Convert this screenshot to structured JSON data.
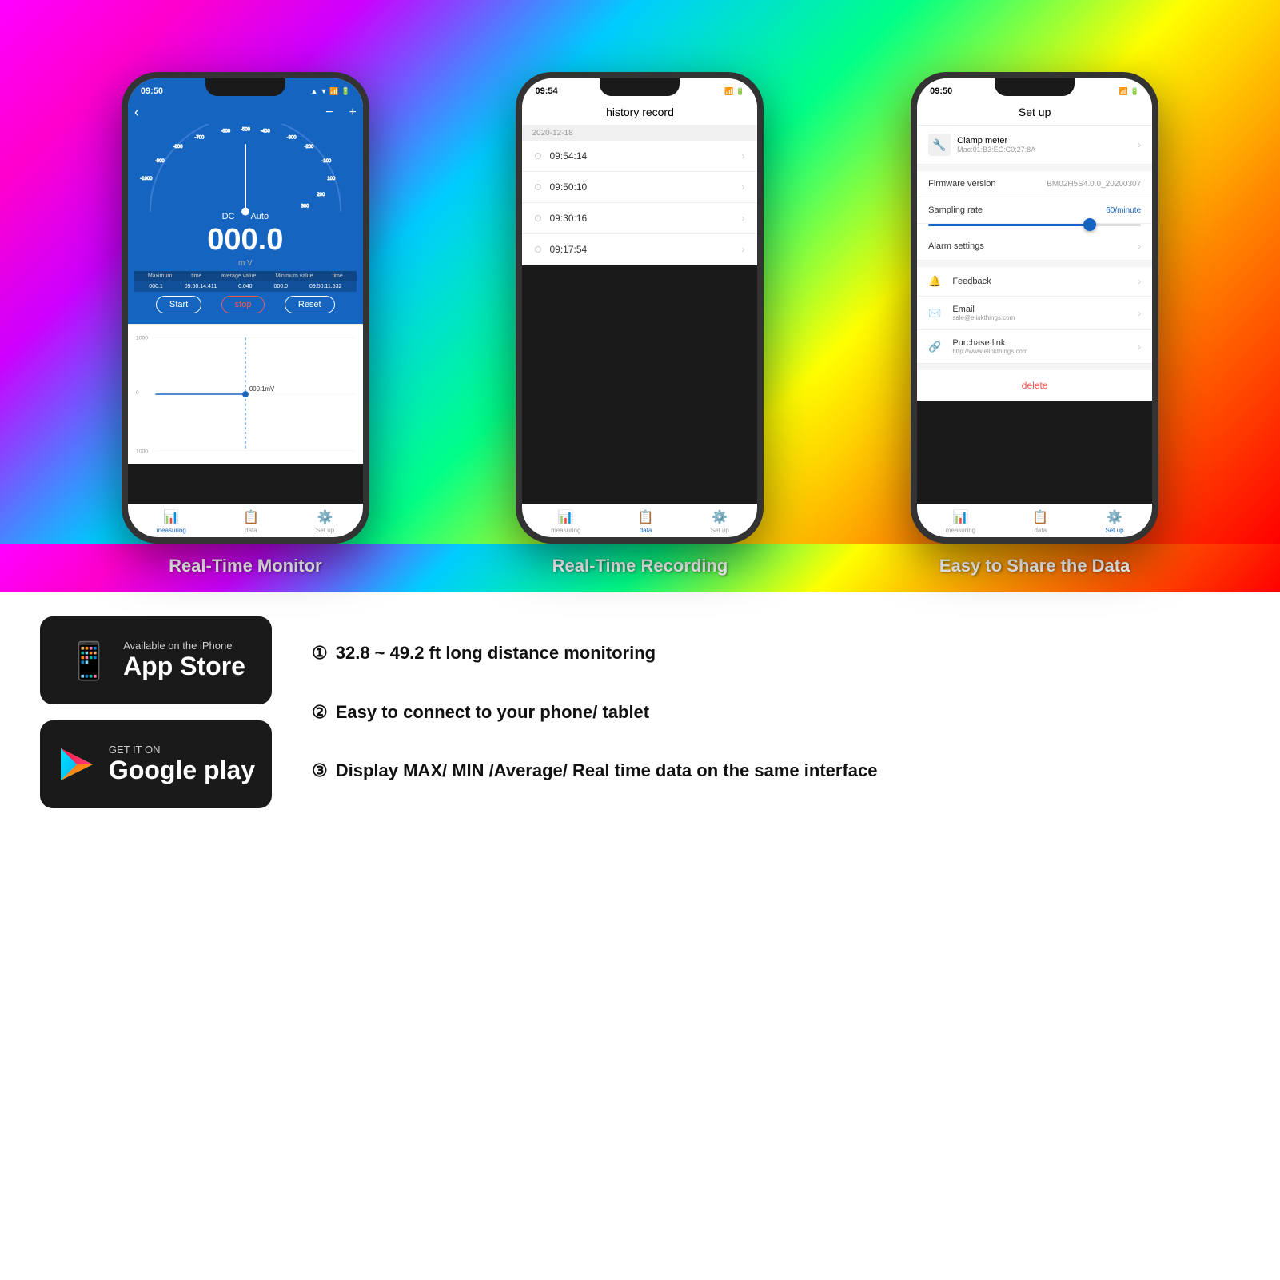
{
  "phones": [
    {
      "name": "measuring",
      "time": "09:50",
      "title": "Real-Time Monitor",
      "dc": "DC",
      "auto": "Auto",
      "value": "000.0",
      "unit": "m V",
      "stats": {
        "max_label": "Maximum",
        "max_val": "000.1",
        "time1_label": "time",
        "time1_val": "09:50:14.411",
        "avg_label": "average value",
        "avg_val": "0.040",
        "min_label": "Minimum value",
        "min_val": "000.0",
        "time2_label": "time",
        "time2_val": "09:50:11.532"
      },
      "buttons": {
        "start": "Start",
        "stop": "stop",
        "reset": "Reset"
      },
      "chart_value": "000.1mV",
      "footer": {
        "measuring": "measuring",
        "data": "data",
        "setup": "Set up"
      }
    },
    {
      "name": "history",
      "time": "09:54",
      "title": "Real-Time Recording",
      "screen_title": "history record",
      "date": "2020-12-18",
      "records": [
        "09:54:14",
        "09:50:10",
        "09:30:16",
        "09:17:54"
      ],
      "footer": {
        "measuring": "measuring",
        "data": "data",
        "setup": "Set up"
      }
    },
    {
      "name": "setup",
      "time": "09:50",
      "title": "Easy to Share the Data",
      "screen_title": "Set up",
      "device": {
        "name": "Clamp meter",
        "mac": "Mac:01:B3:EC:C0:27:8A"
      },
      "firmware_label": "Firmware version",
      "firmware_val": "BM02H5S4.0.0_20200307",
      "sampling_label": "Sampling rate",
      "sampling_val": "60/minute",
      "alarm_label": "Alarm settings",
      "feedback_label": "Feedback",
      "email_label": "Email",
      "email_val": "sale@elinkthings.com",
      "purchase_label": "Purchase link",
      "purchase_val": "http://www.elinkthings.com",
      "delete_label": "delete",
      "footer": {
        "measuring": "measuring",
        "data": "data",
        "setup": "Set up"
      }
    }
  ],
  "badges": {
    "appstore_small": "Available on the iPhone",
    "appstore_big": "App Store",
    "googleplay_small": "GET IT ON",
    "googleplay_big": "Google play"
  },
  "features": [
    {
      "num": "①",
      "text": "32.8 ~ 49.2 ft long distance monitoring"
    },
    {
      "num": "②",
      "text": "Easy to connect to your phone/ tablet"
    },
    {
      "num": "③",
      "text": "Display MAX/ MIN /Average/ Real time data on the same interface"
    }
  ]
}
